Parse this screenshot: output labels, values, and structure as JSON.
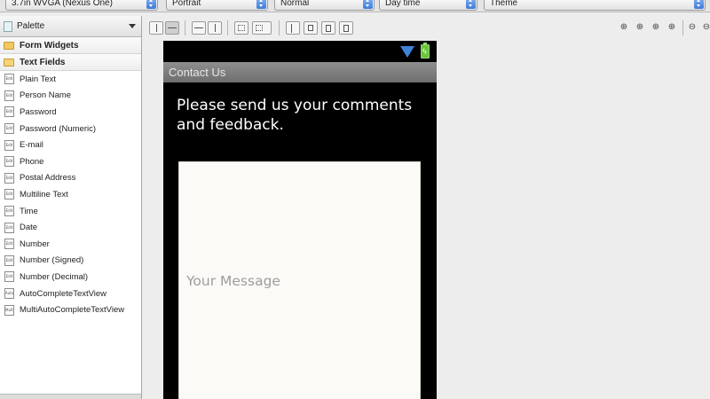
{
  "config": {
    "device": "3.7in WVGA (Nexus One)",
    "orientation": "Portrait",
    "dock": "Normal",
    "time": "Day time",
    "theme": "Theme"
  },
  "palette": {
    "title": "Palette",
    "categories": [
      {
        "label": "Form Widgets"
      },
      {
        "label": "Text Fields"
      }
    ],
    "items": [
      {
        "label": "Plain Text",
        "icon": "Edit"
      },
      {
        "label": "Person Name",
        "icon": "Edit"
      },
      {
        "label": "Password",
        "icon": "Edit"
      },
      {
        "label": "Password (Numeric)",
        "icon": "Edit"
      },
      {
        "label": "E-mail",
        "icon": "Edit"
      },
      {
        "label": "Phone",
        "icon": "Edit"
      },
      {
        "label": "Postal Address",
        "icon": "Edit"
      },
      {
        "label": "Multiline Text",
        "icon": "Edit"
      },
      {
        "label": "Time",
        "icon": "Edit"
      },
      {
        "label": "Date",
        "icon": "Edit"
      },
      {
        "label": "Number",
        "icon": "Edit"
      },
      {
        "label": "Number (Signed)",
        "icon": "Edit"
      },
      {
        "label": "Number (Decimal)",
        "icon": "Edit"
      },
      {
        "label": "AutoCompleteTextView",
        "icon": "Auto"
      },
      {
        "label": "MultiAutoCompleteTextView",
        "icon": "Multi"
      }
    ]
  },
  "device": {
    "title": "Contact Us",
    "prompt": "Please send us your comments and feedback.",
    "message_hint": "Your Message"
  },
  "colors": {
    "wifi": "#3f83d6",
    "battery": "#68c63a",
    "title_bar": "#7f7f7f",
    "selector_arrows": "#3d7ad9"
  }
}
